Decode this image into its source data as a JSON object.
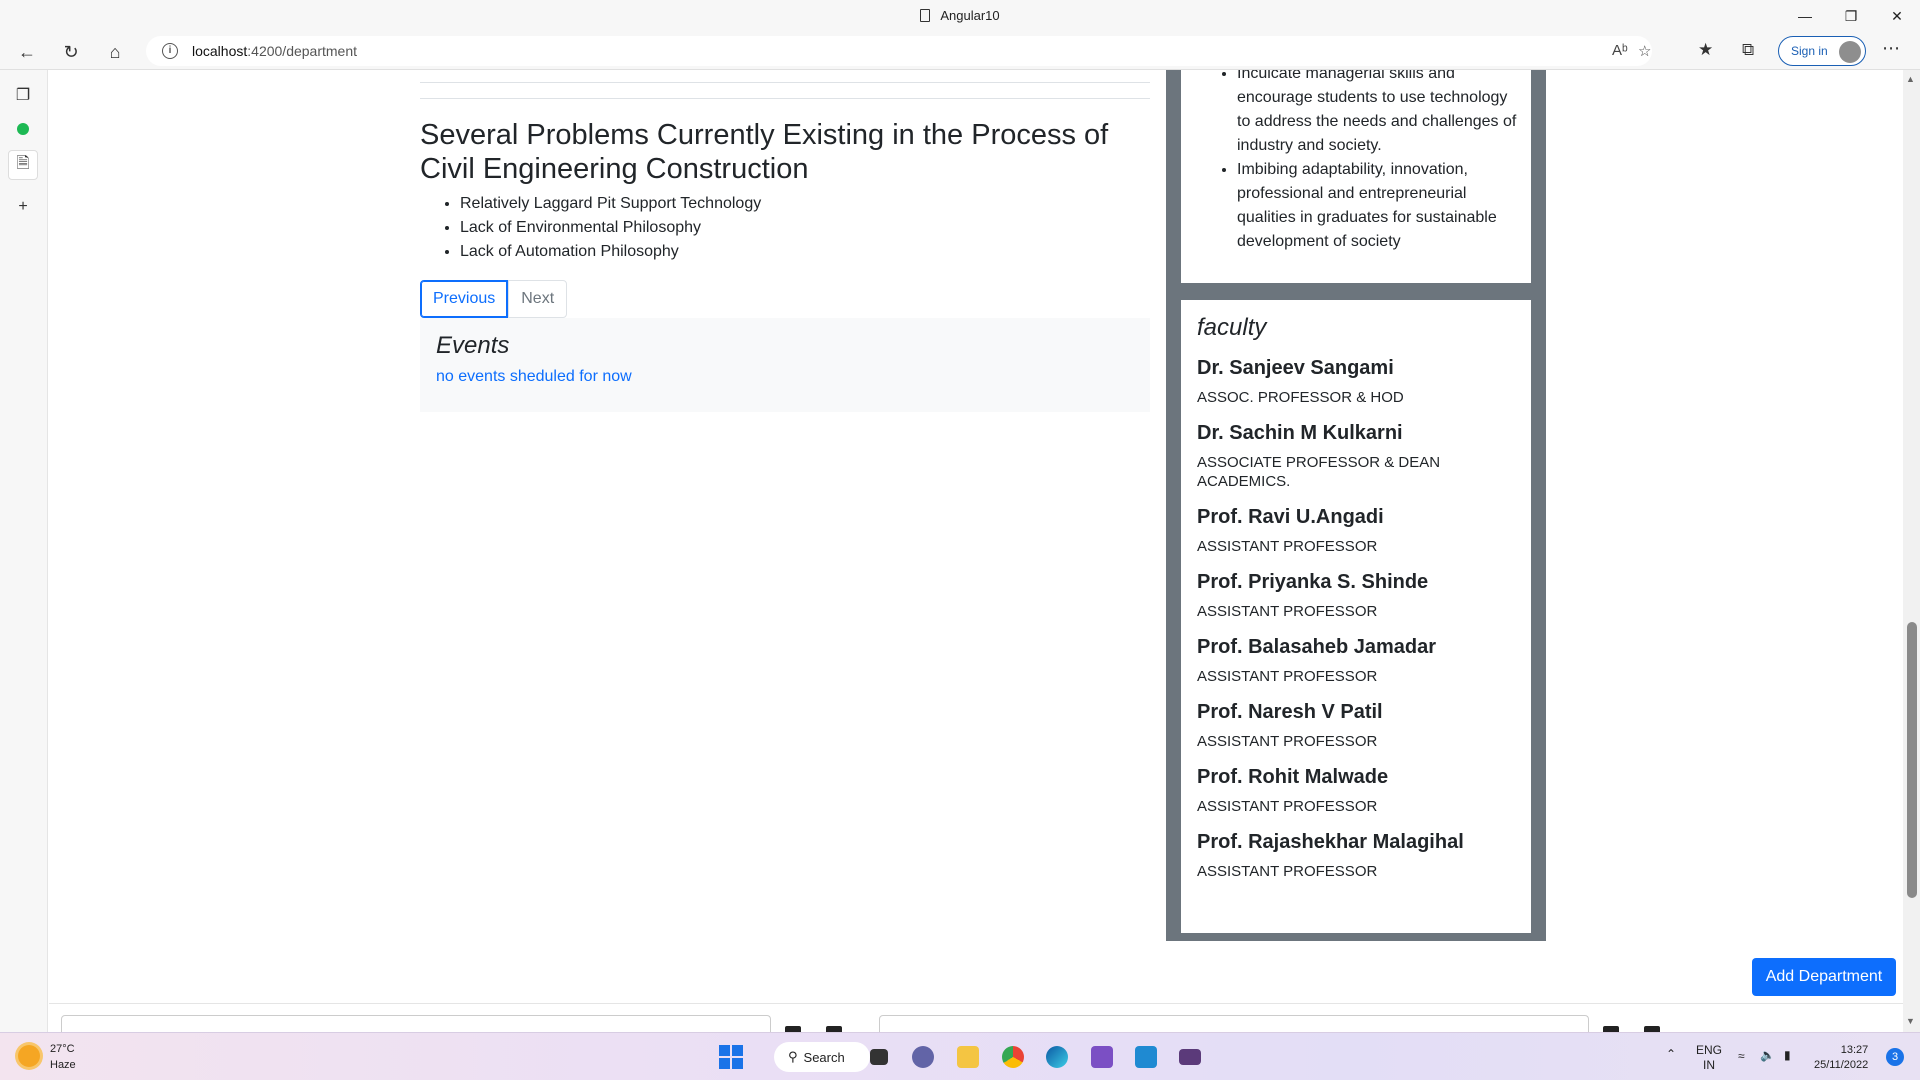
{
  "window": {
    "title": "Angular10",
    "min_icon": "minimize-icon",
    "max_icon": "restore-icon",
    "close_icon": "close-icon"
  },
  "browser": {
    "url_host": "localhost",
    "url_rest": ":4200/department",
    "signin_label": "Sign in"
  },
  "article": {
    "title": "Several Problems Currently Existing in the Process of Civil Engineering Construction",
    "items": [
      "Relatively Laggard Pit Support Technology",
      "Lack of Environmental Philosophy",
      "Lack of Automation Philosophy"
    ]
  },
  "pager": {
    "previous": "Previous",
    "next": "Next"
  },
  "events": {
    "heading": "Events",
    "message": "no events sheduled for now"
  },
  "vision": {
    "items": [
      "Inculcate managerial skills and encourage students to use technology to address the needs and challenges of industry and society.",
      "Imbibing adaptability, innovation, professional and entrepreneurial qualities in graduates for sustainable development of society"
    ]
  },
  "faculty": {
    "heading": "faculty",
    "members": [
      {
        "name": "Dr. Sanjeev Sangami",
        "role": "ASSOC. PROFESSOR & HOD"
      },
      {
        "name": "Dr. Sachin M Kulkarni",
        "role": "ASSOCIATE PROFESSOR & DEAN ACADEMICS."
      },
      {
        "name": "Prof. Ravi U.Angadi",
        "role": "ASSISTANT PROFESSOR"
      },
      {
        "name": "Prof. Priyanka S. Shinde",
        "role": "ASSISTANT PROFESSOR"
      },
      {
        "name": "Prof. Balasaheb Jamadar",
        "role": "ASSISTANT PROFESSOR"
      },
      {
        "name": "Prof. Naresh V Patil",
        "role": "ASSISTANT PROFESSOR"
      },
      {
        "name": "Prof. Rohit Malwade",
        "role": "ASSISTANT PROFESSOR"
      },
      {
        "name": "Prof. Rajashekhar Malagihal",
        "role": "ASSISTANT PROFESSOR"
      }
    ]
  },
  "actions": {
    "add_department": "Add Department"
  },
  "taskbar": {
    "temp": "27°C",
    "weather": "Haze",
    "search": "Search",
    "lang1": "ENG",
    "lang2": "IN",
    "time": "13:27",
    "date": "25/11/2022",
    "notifications": "3"
  },
  "colors": {
    "primary": "#0d6efd",
    "aside_bg": "#6c757d",
    "events_bg": "#f8f9fa"
  }
}
